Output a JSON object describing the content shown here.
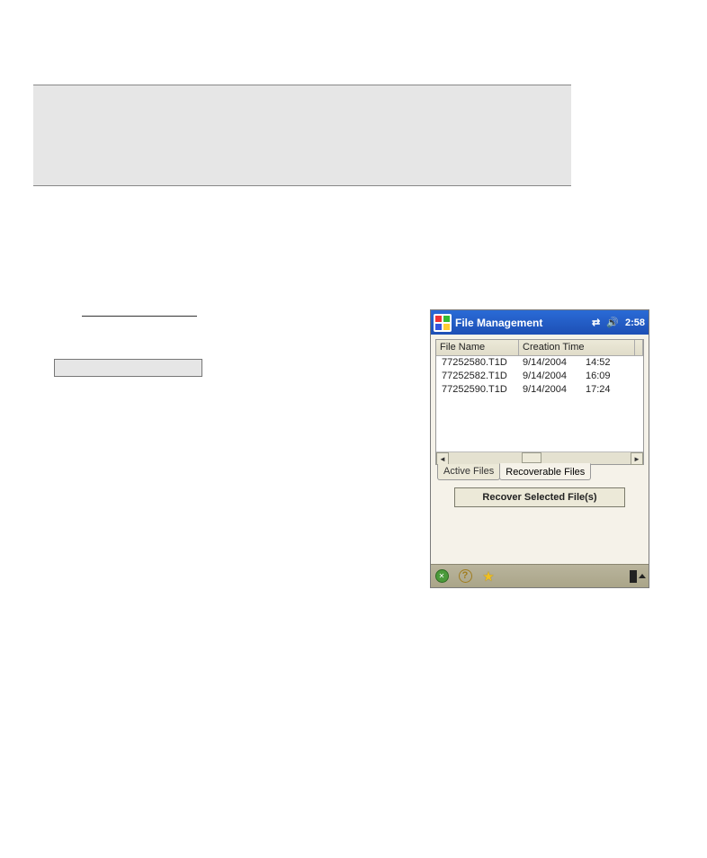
{
  "titlebar": {
    "app_title": "File Management",
    "clock": "2:58"
  },
  "list": {
    "headers": {
      "name": "File Name",
      "time": "Creation Time"
    },
    "rows": [
      {
        "name": "77252580.T1D",
        "date": "9/14/2004",
        "time": "14:52"
      },
      {
        "name": "77252582.T1D",
        "date": "9/14/2004",
        "time": "16:09"
      },
      {
        "name": "77252590.T1D",
        "date": "9/14/2004",
        "time": "17:24"
      }
    ]
  },
  "tabs": {
    "active": "Active Files",
    "recoverable": "Recoverable Files"
  },
  "buttons": {
    "recover": "Recover Selected File(s)"
  }
}
